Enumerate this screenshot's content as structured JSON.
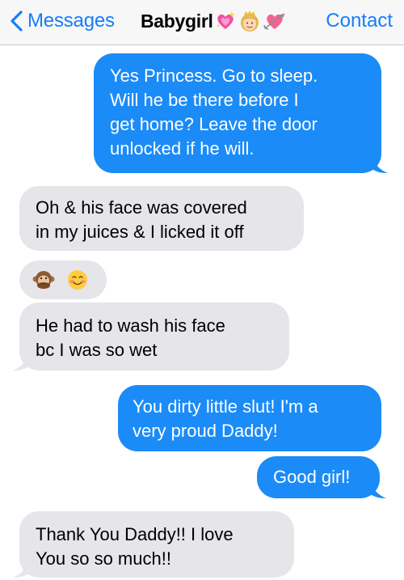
{
  "nav": {
    "back_label": "Messages",
    "title": "Babygirl",
    "title_emojis": [
      "sparkling-heart-icon",
      "princess-icon",
      "heart-with-arrow-icon"
    ],
    "contact_label": "Contact",
    "accent_color": "#147efb"
  },
  "colors": {
    "sent_bubble": "#1b8bf7",
    "received_bubble": "#e5e5ea"
  },
  "messages": [
    {
      "direction": "sent",
      "lines": [
        "Yes Princess. Go to sleep.",
        "Will he be there before I",
        "get home? Leave the door",
        "unlocked if he will."
      ]
    },
    {
      "direction": "received",
      "lines": [
        "Oh & his face was covered",
        "in my juices & I licked it off"
      ]
    },
    {
      "direction": "received",
      "emojis": [
        "speak-no-evil-monkey-icon",
        "smiling-blushing-face-icon"
      ]
    },
    {
      "direction": "received",
      "lines": [
        "He had to wash his face",
        "bc I was so wet"
      ]
    },
    {
      "direction": "sent",
      "lines": [
        "You dirty little slut! I'm a",
        "very proud Daddy!"
      ]
    },
    {
      "direction": "sent",
      "lines": [
        "Good girl!"
      ]
    },
    {
      "direction": "received",
      "lines": [
        "Thank You Daddy!! I love",
        "You so so much!!"
      ]
    }
  ]
}
